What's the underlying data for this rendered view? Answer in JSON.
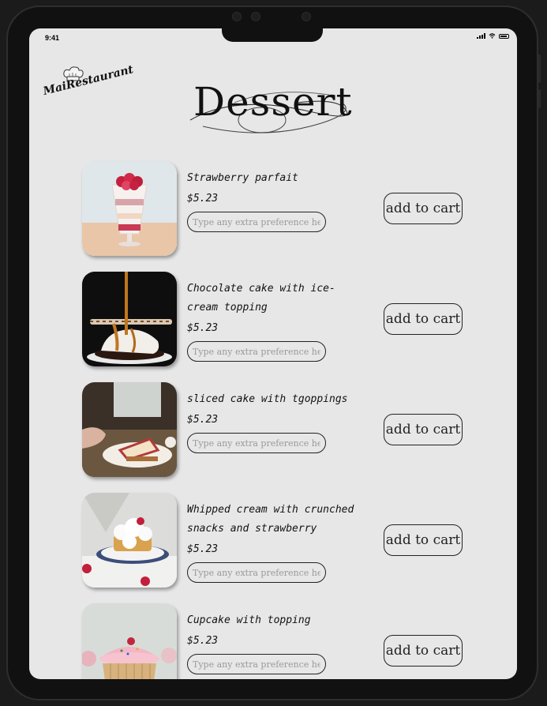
{
  "status_bar": {
    "time": "9:41"
  },
  "brand": {
    "name": "MaiRestaurant"
  },
  "page": {
    "title": "Dessert"
  },
  "items": [
    {
      "name": "Strawberry parfait",
      "price": "$5.23",
      "placeholder": "Type any extra preference here",
      "button": "add to cart"
    },
    {
      "name": "Chocolate cake with ice-cream topping",
      "price": "$5.23",
      "placeholder": "Type any extra preference here",
      "button": "add to cart"
    },
    {
      "name": "sliced cake with tgoppings",
      "price": "$5.23",
      "placeholder": "Type any extra preference here",
      "button": "add to cart"
    },
    {
      "name": "Whipped cream with crunched snacks and strawberry",
      "price": "$5.23",
      "placeholder": "Type any extra preference here",
      "button": "add to cart"
    },
    {
      "name": "Cupcake with topping",
      "price": "$5.23",
      "placeholder": "Type any extra preference here",
      "button": "add to cart"
    }
  ],
  "icons": {
    "logo": "chef-hat-icon",
    "status": [
      "signal-icon",
      "wifi-icon",
      "battery-icon"
    ]
  },
  "colors": {
    "screen_background": "#e7e7e7",
    "device_frame": "#111111",
    "text": "#111111"
  }
}
